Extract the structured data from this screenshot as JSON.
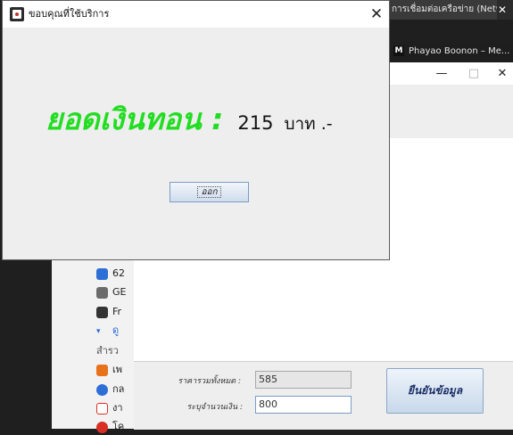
{
  "dialog": {
    "title": "ขอบคุณที่ใช้บริการ",
    "message_label": "ยอดเงินทอน :",
    "change_amount": "215",
    "currency": "บาท .-",
    "exit_button": "ออก"
  },
  "background_window": {
    "total_label": "ราคารวมทั้งหมด :",
    "total_value": "585",
    "payment_label": "ระบุจำนวนเงิน :",
    "payment_value": "800",
    "confirm_button": "ยืนยันข้อมูล",
    "minimize": "—",
    "maximize": "□",
    "close": "✕"
  },
  "browser": {
    "tab_title": "การเชื่อมต่อเครือข่าย (Network",
    "tab_close": "✕",
    "bookmark_1": "Phayao Boonon – Me..."
  },
  "sidebar": {
    "items": [
      {
        "label": "62",
        "icon": "calendar-icon",
        "color": "#2e6fd6"
      },
      {
        "label": "GE",
        "icon": "group-icon",
        "color": "#6b6b6b"
      },
      {
        "label": "Fr",
        "icon": "graduation-cap-icon",
        "color": "#333333"
      },
      {
        "label": "ดู",
        "icon": "chevron-down-icon",
        "color": "#2e6fd6"
      },
      {
        "label": "สำรว",
        "icon": "",
        "color": ""
      },
      {
        "label": "เพ",
        "icon": "flag-icon",
        "color": "#e8711c"
      },
      {
        "label": "กล",
        "icon": "people-icon",
        "color": "#2e6fd6"
      },
      {
        "label": "งา",
        "icon": "calendar-12-icon",
        "color": "#d93025"
      },
      {
        "label": "โค",
        "icon": "heart-icon",
        "color": "#d93025"
      }
    ]
  },
  "colors": {
    "message_green": "#22dd22",
    "dialog_background": "#eeeeee",
    "button_gradient_top": "#f2f6fb",
    "button_gradient_bottom": "#cfdcec"
  }
}
